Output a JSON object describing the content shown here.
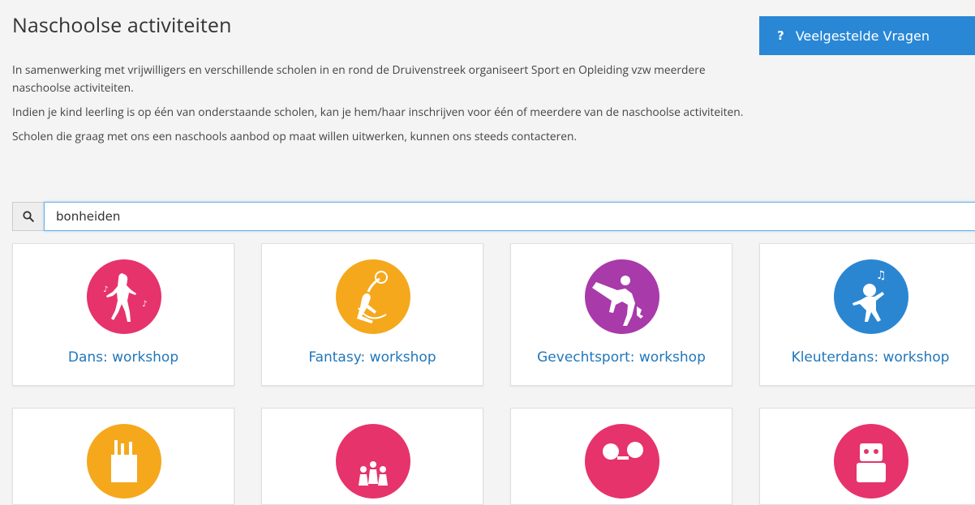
{
  "page": {
    "title": "Naschoolse activiteiten",
    "faq_label": "Veelgestelde Vragen",
    "faq_icon": "?"
  },
  "intro": [
    "In samenwerking met vrijwilligers en verschillende scholen in en rond de Druivenstreek organiseert Sport en Opleiding vzw meerdere naschoolse activiteiten.",
    "Indien je kind leerling is op één van onderstaande scholen, kan je hem/haar inschrijven voor één of meerdere van de naschoolse activiteiten.",
    "Scholen die graag met ons een naschools aanbod op maat willen uitwerken, kunnen ons steeds contacteren."
  ],
  "search": {
    "value": "bonheiden",
    "icon": "search-icon"
  },
  "activities": [
    {
      "label": "Dans: workshop",
      "color": "#e6336b",
      "icon": "dancer-icon"
    },
    {
      "label": "Fantasy: workshop",
      "color": "#f5a81c",
      "icon": "fairy-icon"
    },
    {
      "label": "Gevechtsport: workshop",
      "color": "#a93aa9",
      "icon": "martial-arts-icon"
    },
    {
      "label": "Kleuterdans: workshop",
      "color": "#2b86d1",
      "icon": "toddler-dance-icon"
    },
    {
      "label": "",
      "color": "#f5a81c",
      "icon": "craft-supplies-icon"
    },
    {
      "label": "",
      "color": "#e6336b",
      "icon": "kids-group-icon"
    },
    {
      "label": "",
      "color": "#e6336b",
      "icon": "music-kids-icon"
    },
    {
      "label": "",
      "color": "#e6336b",
      "icon": "robot-icon"
    }
  ]
}
